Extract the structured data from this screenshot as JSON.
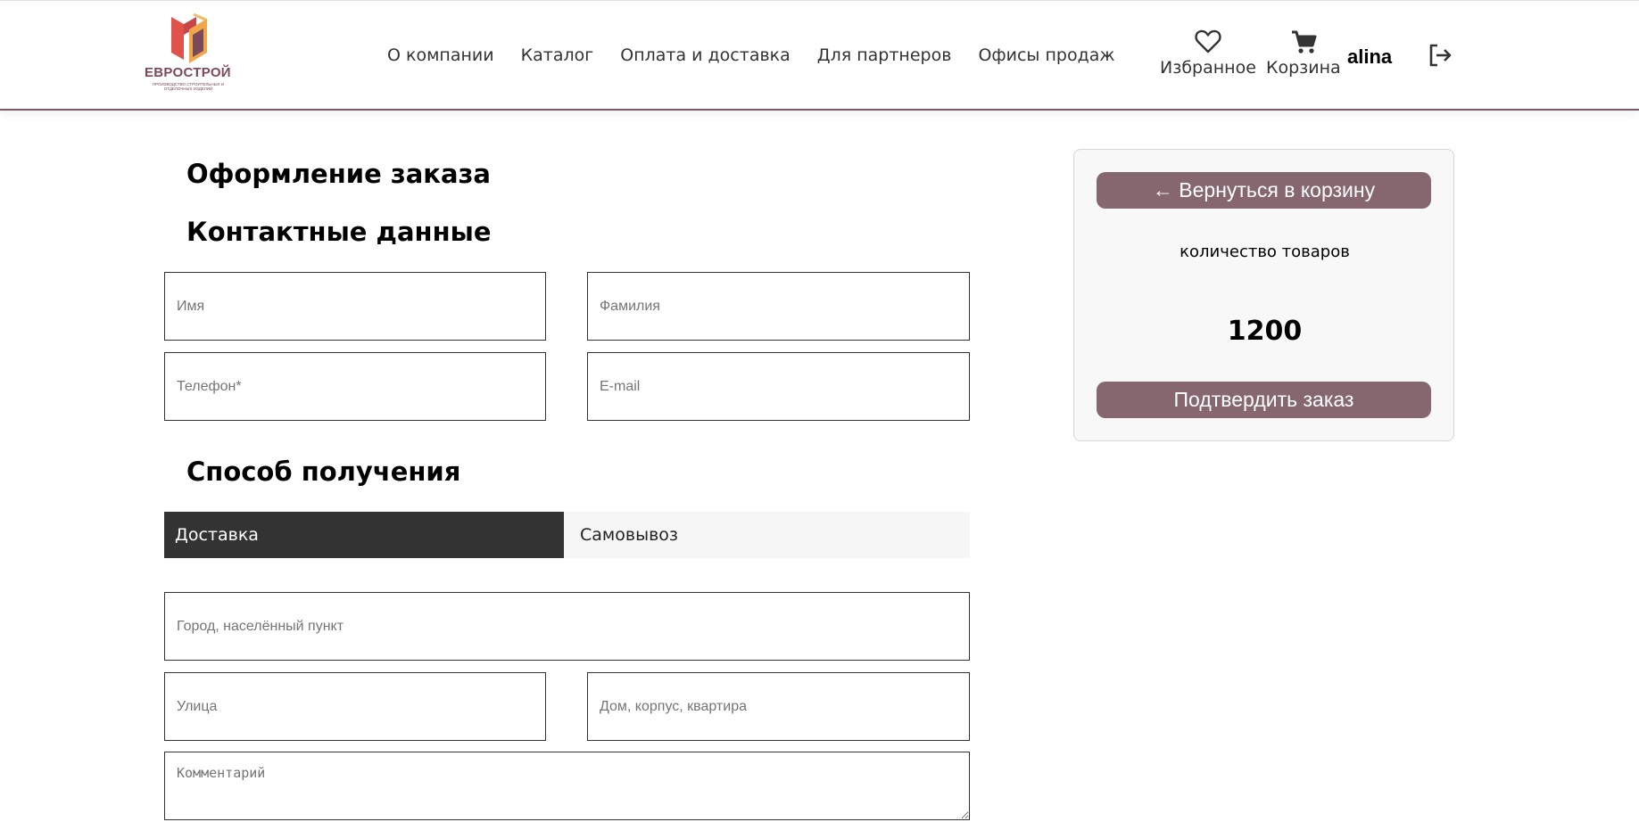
{
  "header": {
    "logo": {
      "brand": "ЕВРОСТРОЙ",
      "tagline": "ПРОИЗВОДСТВО СТРОИТЕЛЬНЫХ И ОТДЕЛОЧНЫХ ИЗДЕЛИЙ"
    },
    "nav": [
      {
        "label": "О компании"
      },
      {
        "label": "Каталог"
      },
      {
        "label": "Оплата и доставка"
      },
      {
        "label": "Для партнеров"
      },
      {
        "label": "Офисы продаж"
      }
    ],
    "favorites_label": "Избранное",
    "cart_label": "Корзина",
    "username": "alina",
    "icons": {
      "favorites": "heart-icon",
      "cart": "cart-icon",
      "logout": "logout-icon"
    }
  },
  "order": {
    "title": "Оформление заказа",
    "contact_title": "Контактные данные",
    "fields": {
      "first_name": {
        "placeholder": "Имя",
        "value": ""
      },
      "last_name": {
        "placeholder": "Фамилия",
        "value": ""
      },
      "phone": {
        "placeholder": "Телефон*",
        "value": ""
      },
      "email": {
        "placeholder": "E-mail",
        "value": ""
      },
      "city": {
        "placeholder": "Город, населённый пункт",
        "value": ""
      },
      "street": {
        "placeholder": "Улица",
        "value": ""
      },
      "house": {
        "placeholder": "Дом, корпус, квартира",
        "value": ""
      },
      "comment": {
        "placeholder": "Комментарий",
        "value": ""
      }
    },
    "delivery_title": "Способ получения",
    "delivery_tabs": [
      {
        "label": "Доставка",
        "selected": true
      },
      {
        "label": "Самовывоз",
        "selected": false
      }
    ]
  },
  "summary": {
    "back_label": "← Вернуться в корзину",
    "qty_label": "количество товаров",
    "qty_value": "1200",
    "confirm_label": "Подтвердить заказ"
  },
  "colors": {
    "accent": "#86666f",
    "header_border": "#7a5a63",
    "tab_active": "#333333",
    "logo_red": "#d9534f",
    "logo_orange": "#f0a64b",
    "logo_purple": "#7a4a5a"
  }
}
